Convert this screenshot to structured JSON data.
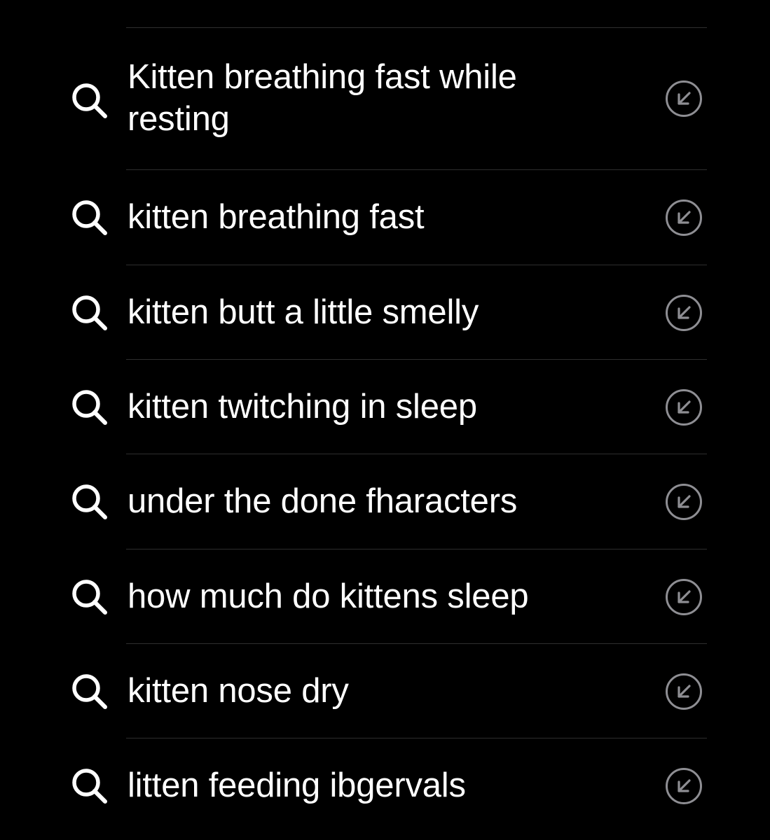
{
  "suggestions": [
    {
      "text": "Kitten breathing fast while resting",
      "icon": "search-icon",
      "action_icon": "arrow-up-left-icon"
    },
    {
      "text": "kitten breathing fast",
      "icon": "search-icon",
      "action_icon": "arrow-up-left-icon"
    },
    {
      "text": "kitten butt a little smelly",
      "icon": "search-icon",
      "action_icon": "arrow-up-left-icon"
    },
    {
      "text": "kitten twitching in sleep",
      "icon": "search-icon",
      "action_icon": "arrow-up-left-icon"
    },
    {
      "text": "under the done fharacters",
      "icon": "search-icon",
      "action_icon": "arrow-up-left-icon"
    },
    {
      "text": "how much do kittens sleep",
      "icon": "search-icon",
      "action_icon": "arrow-up-left-icon"
    },
    {
      "text": "kitten nose dry",
      "icon": "search-icon",
      "action_icon": "arrow-up-left-icon"
    },
    {
      "text": "litten feeding ibgervals",
      "icon": "search-icon",
      "action_icon": "arrow-up-left-icon"
    }
  ],
  "colors": {
    "background": "#000000",
    "text": "#ffffff",
    "divider": "#2e2e2e",
    "arrow_circle": "#8e8e93"
  }
}
